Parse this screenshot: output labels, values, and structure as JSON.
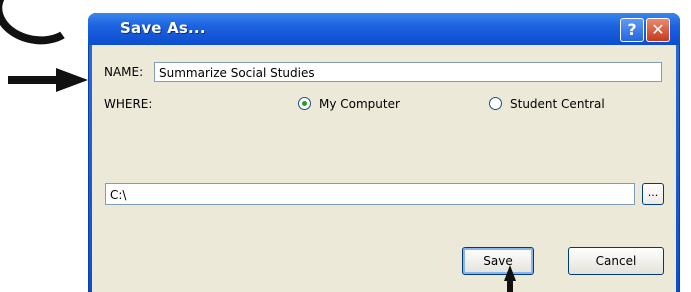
{
  "window": {
    "title": "Save As...",
    "help_label": "?",
    "close_label": "✕"
  },
  "form": {
    "name_label": "NAME:",
    "name_value": "Summarize Social Studies",
    "where_label": "WHERE:",
    "where_options": [
      {
        "label": "My Computer",
        "selected": true
      },
      {
        "label": "Student Central",
        "selected": false
      }
    ],
    "path_value": "C:\\",
    "browse_label": "..."
  },
  "buttons": {
    "save_label": "Save",
    "cancel_label": "Cancel"
  },
  "colors": {
    "titlebar": "#0b4fcf",
    "client": "#ece9d8",
    "radio_selected": "#21a121"
  },
  "icons": [
    "help-icon",
    "close-icon",
    "pointer-arrow-icon"
  ]
}
